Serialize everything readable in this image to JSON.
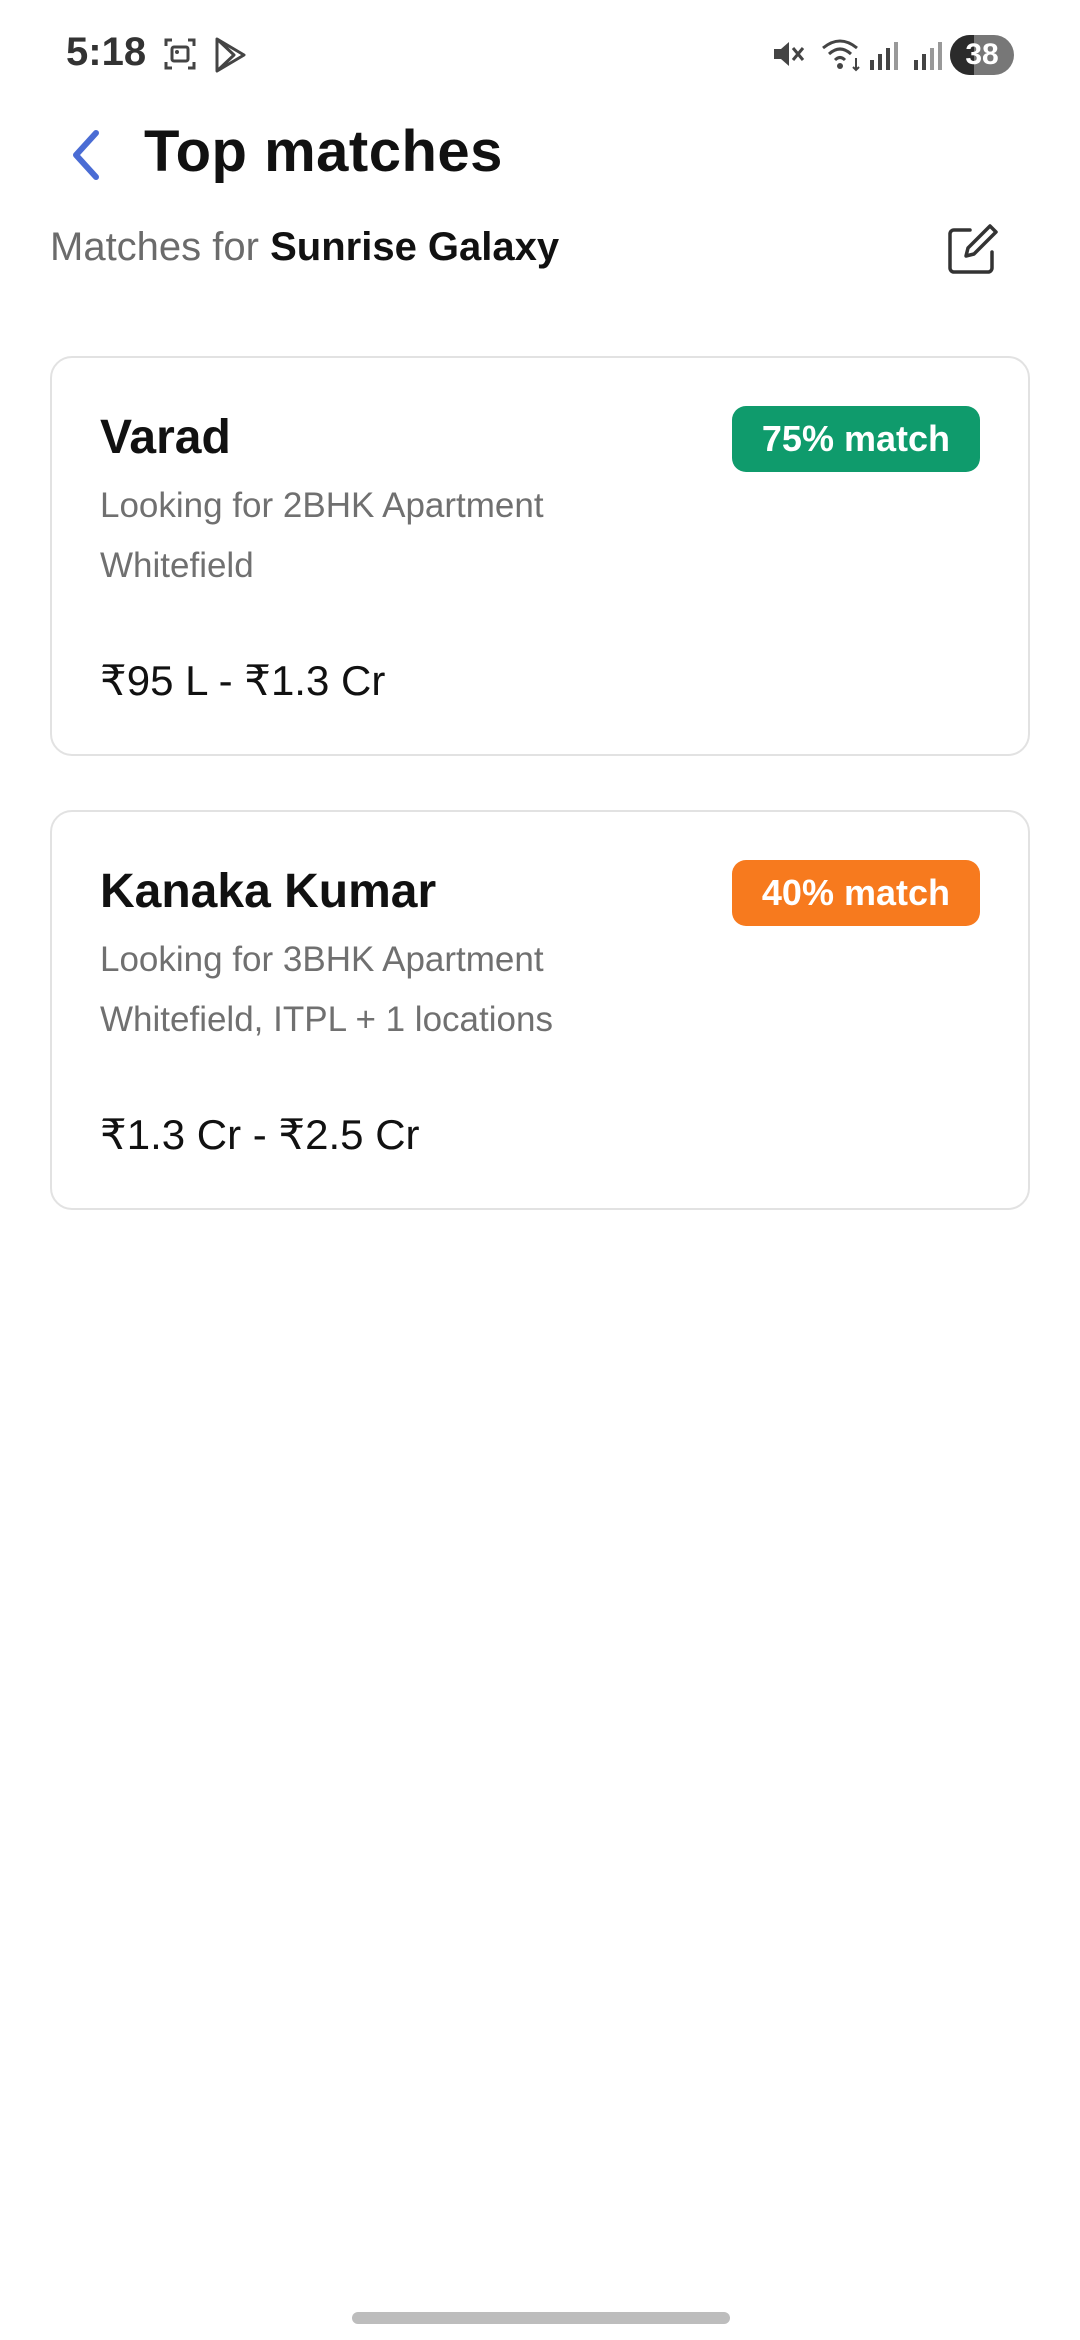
{
  "status_bar": {
    "time": "5:18",
    "battery": "38",
    "icons": [
      "screenshot-icon",
      "play-store-icon",
      "mute-icon",
      "wifi-icon",
      "signal-icon",
      "signal-icon"
    ]
  },
  "header": {
    "title": "Top matches",
    "subtitle_prefix": "Matches for",
    "project_name": "Sunrise Galaxy"
  },
  "matches": [
    {
      "name": "Varad",
      "match": "75% match",
      "badge_color": "#0f9b6c",
      "looking_for": "Looking for 2BHK Apartment",
      "locations": "Whitefield",
      "budget": "₹95 L - ₹1.3 Cr"
    },
    {
      "name": "Kanaka Kumar",
      "match": "40% match",
      "badge_color": "#f77a1e",
      "looking_for": "Looking for 3BHK Apartment",
      "locations": "Whitefield, ITPL + 1 locations",
      "budget": "₹1.3 Cr - ₹2.5 Cr"
    }
  ],
  "colors": {
    "accent": "#4a6cd4",
    "card_border": "#e2e2e2"
  }
}
